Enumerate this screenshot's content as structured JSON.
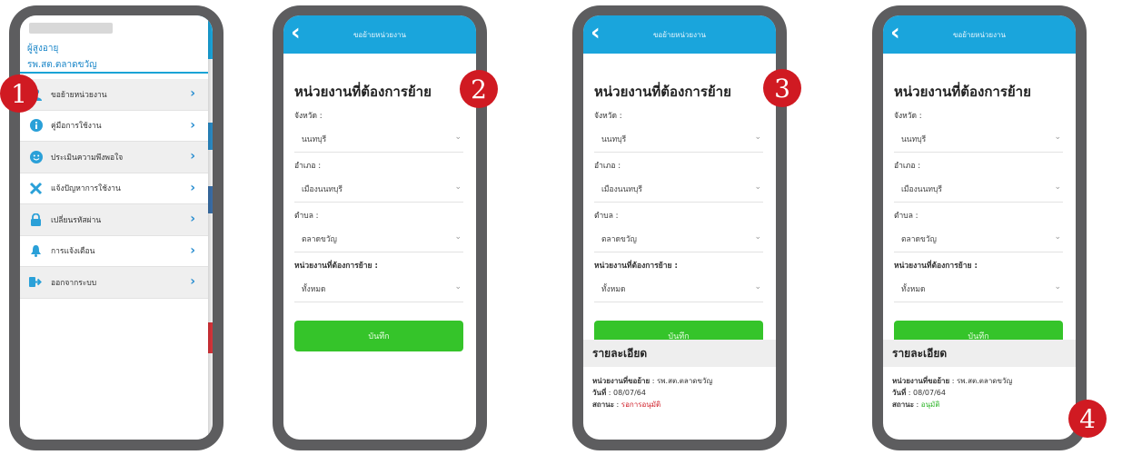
{
  "colors": {
    "topbar": "#1aa5dc",
    "save_button": "#35c42a",
    "badge": "#d01a22",
    "frame": "#5d5d5f",
    "status_pending": "#d0202a",
    "status_approved": "#2fb52a"
  },
  "badges": [
    "1",
    "2",
    "3",
    "4"
  ],
  "menu_screen": {
    "user_role": "ผู้สูงอายุ",
    "user_place": "รพ.สต.ตลาดขวัญ",
    "items": [
      {
        "label": "ขอย้ายหน่วยงาน",
        "icon": "user-icon"
      },
      {
        "label": "คู่มือการใช้งาน",
        "icon": "info-icon"
      },
      {
        "label": "ประเมินความพึงพอใจ",
        "icon": "smiley-icon"
      },
      {
        "label": "แจ้งปัญหาการใช้งาน",
        "icon": "tools-icon"
      },
      {
        "label": "เปลี่ยนรหัสผ่าน",
        "icon": "lock-icon"
      },
      {
        "label": "การแจ้งเตือน",
        "icon": "bell-icon"
      },
      {
        "label": "ออกจากระบบ",
        "icon": "logout-icon"
      }
    ]
  },
  "form": {
    "title": "ขอย้ายหน่วยงาน",
    "heading": "หน่วยงานที่ต้องการย้าย",
    "province_label": "จังหวัด :",
    "province_value": "นนทบุรี",
    "district_label": "อำเภอ :",
    "district_value": "เมืองนนทบุรี",
    "subdistrict_label": "ตำบล :",
    "subdistrict_value": "ตลาดขวัญ",
    "unit_label": "หน่วยงานที่ต้องการย้าย :",
    "unit_value": "ทั้งหมด",
    "save_label": "บันทึก"
  },
  "details": {
    "heading": "รายละเอียด",
    "unit_key": "หน่วยงานที่ขอย้าย",
    "unit_value": " : รพ.สต.ตลาดขวัญ",
    "date_key": "วันที่",
    "date_value": " : 08/07/64",
    "status_key": "สถานะ",
    "status_sep": " : ",
    "status_pending": "รอการอนุมัติ",
    "status_approved": "อนุมัติ"
  }
}
